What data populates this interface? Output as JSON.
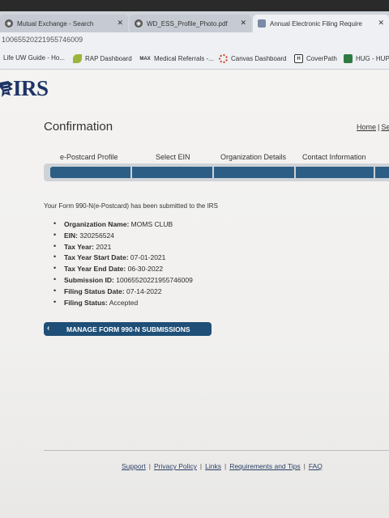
{
  "browser": {
    "tabs": [
      {
        "title": "Mutual Exchange - Search",
        "icon": "globe-icon"
      },
      {
        "title": "WD_ESS_Profile_Photo.pdf",
        "icon": "globe-icon"
      },
      {
        "title": "Annual Electronic Filing Require",
        "icon": "document-icon"
      }
    ],
    "close_glyph": "✕",
    "url": "10065520221955746009",
    "bookmarks": [
      {
        "label": "Life UW Guide - Ho..."
      },
      {
        "label": "RAP Dashboard"
      },
      {
        "label": "Medical Referrals -..."
      },
      {
        "label": "Canvas Dashboard"
      },
      {
        "label": "CoverPath"
      },
      {
        "label": "HUG - HUP"
      }
    ],
    "bookmark_icon_text": {
      "med": "MAX",
      "cover": "H"
    }
  },
  "header": {
    "logo_text": "IRS",
    "page_title": "Confirmation",
    "home_link": "Home",
    "next_link": "Se"
  },
  "steps": [
    {
      "label": "e-Postcard Profile"
    },
    {
      "label": "Select EIN"
    },
    {
      "label": "Organization Details"
    },
    {
      "label": "Contact Information"
    }
  ],
  "confirmation": {
    "message": "Your Form 990-N(e-Postcard) has been submitted to the IRS",
    "details": [
      {
        "label": "Organization Name:",
        "value": "MOMS CLUB"
      },
      {
        "label": "EIN:",
        "value": "320256524"
      },
      {
        "label": "Tax Year:",
        "value": "2021"
      },
      {
        "label": "Tax Year Start Date:",
        "value": "07-01-2021"
      },
      {
        "label": "Tax Year End Date:",
        "value": "06-30-2022"
      },
      {
        "label": "Submission ID:",
        "value": "10065520221955746009"
      },
      {
        "label": "Filing Status Date:",
        "value": "07-14-2022"
      },
      {
        "label": "Filing Status:",
        "value": "Accepted"
      }
    ],
    "manage_button_chevron": "‹",
    "manage_button": "MANAGE FORM 990-N SUBMISSIONS"
  },
  "footer": {
    "links": [
      "Support",
      "Privacy Policy",
      "Links",
      "Requirements and Tips",
      "FAQ"
    ],
    "separator": "|"
  },
  "colors": {
    "irs_navy": "#1e3466",
    "progress_blue": "#2c5d85",
    "button_blue": "#1f4f77"
  }
}
